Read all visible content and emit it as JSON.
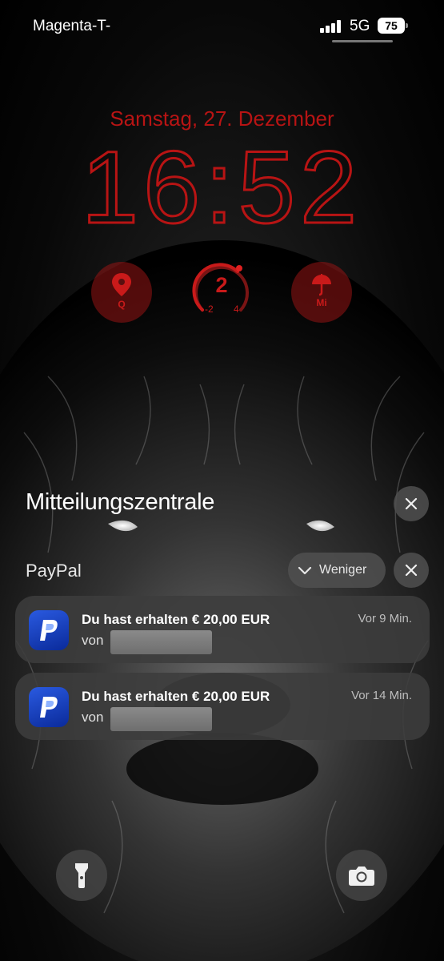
{
  "status_bar": {
    "carrier": "Magenta-T-",
    "network": "5G",
    "battery": "75"
  },
  "lock_screen": {
    "date": "Samstag, 27. Dezember",
    "time": "16:52",
    "accent_color": "#c91a1a"
  },
  "widgets": {
    "location": {
      "icon": "location-pin-icon",
      "label": "Q"
    },
    "gauge": {
      "value": "2",
      "min": "-2",
      "max": "4"
    },
    "rain": {
      "icon": "umbrella-icon",
      "label": "Mi"
    }
  },
  "notification_center": {
    "title": "Mitteilungszentrale",
    "group": {
      "app": "PayPal",
      "less_label": "Weniger",
      "notifications": [
        {
          "title": "Du hast erhalten € 20,00 EUR",
          "subtitle": "von",
          "time": "Vor 9 Min."
        },
        {
          "title": "Du hast erhalten € 20,00 EUR",
          "subtitle": "von",
          "time": "Vor 14 Min."
        }
      ]
    }
  },
  "bottom_actions": {
    "left": "flashlight-icon",
    "right": "camera-icon"
  }
}
